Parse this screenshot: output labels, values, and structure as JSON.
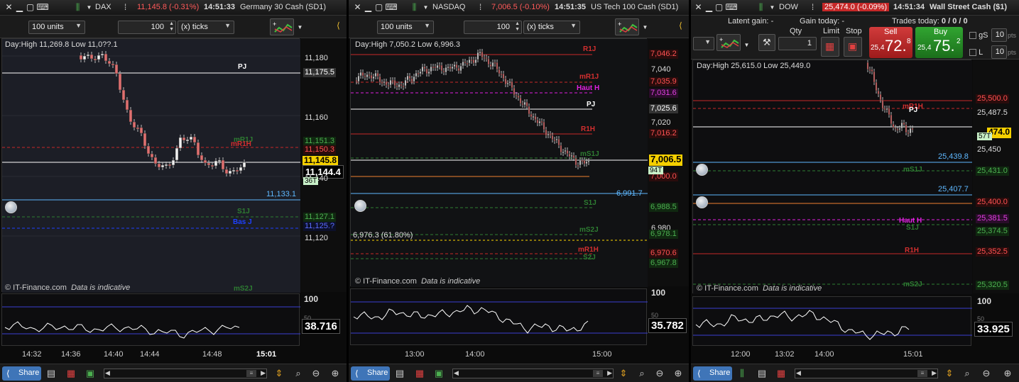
{
  "panels": [
    {
      "title": {
        "symbol": "DAX",
        "change": "11,145.8 (-0.31%)",
        "time": "14:51:33",
        "name": "Germany 30 Cash (SD1)"
      },
      "units": "100 units",
      "qty": "100",
      "ticks": "(x) ticks",
      "dayhl": "Day:High 11,269.8 Low 11,0??.1",
      "yticks": [
        "11,180",
        "11,160",
        "11,140",
        "11,120"
      ],
      "levels": [
        {
          "name": "PJ",
          "price": "11,175.5"
        },
        {
          "name": "mR1H",
          "price": "11,150.3"
        },
        {
          "name": "mR1J",
          "price": "11,151.3"
        },
        {
          "name": "S1J",
          "price": "11,127.1"
        },
        {
          "name": "Bas J",
          "price": "11,125.?"
        },
        {
          "name": "mS2J",
          "price": ""
        }
      ],
      "last": "11,145.8",
      "bid": "11,144.4",
      "tick_badge": "36T",
      "alert_price": "11,133.1",
      "footer": "© IT-Finance.com",
      "footer_note": "Data is indicative",
      "osc": {
        "top": "100",
        "mid": "50",
        "value": "38.716"
      },
      "times": [
        "14:32",
        "14:36",
        "14:40",
        "14:44",
        "14:48",
        "15:01"
      ],
      "share": "Share"
    },
    {
      "title": {
        "symbol": "NASDAQ",
        "change": "7,006.5 (-0.10%)",
        "time": "14:51:35",
        "name": "US Tech 100 Cash (SD1)"
      },
      "units": "100 units",
      "qty": "100",
      "ticks": "(x) ticks",
      "dayhl": "Day:High 7,050.2 Low 6,996.3",
      "yticks": [
        "7,040",
        "7,020",
        "6,980"
      ],
      "levels": [
        {
          "name": "R1J",
          "price": "7,046.2"
        },
        {
          "name": "mR1J",
          "price": "7,035.9"
        },
        {
          "name": "Haut H",
          "price": "7,031.6"
        },
        {
          "name": "PJ",
          "price": "7,025.6"
        },
        {
          "name": "R1H",
          "price": "7,016.2"
        },
        {
          "name": "mS1J",
          "price": "7,000.0"
        },
        {
          "name": "S1J",
          "price": "6,988.5"
        },
        {
          "name": "mS2J",
          "price": "6,978.1"
        },
        {
          "name": "mR1H",
          "price": "6,970.6"
        },
        {
          "name": "S2J",
          "price": "6,967.8"
        }
      ],
      "last": "7,006.5",
      "tick_badge": "94T",
      "alert_price": "6,991.7",
      "fib": "6,976.3 (61.80%)",
      "footer": "© IT-Finance.com",
      "footer_note": "Data is indicative",
      "osc": {
        "top": "100",
        "mid": "50",
        "value": "35.782"
      },
      "times": [
        "13:00",
        "14:00",
        "15:00"
      ],
      "share": "Share"
    },
    {
      "title": {
        "symbol": "DOW",
        "change": "25,474.0 (-0.09%)",
        "time": "14:51:34",
        "name": "Wall Street Cash ($1)"
      },
      "trade": {
        "latent": "Latent gain:",
        "latent_val": "-",
        "gain_today": "Gain today:",
        "gain_val": "-",
        "trades_today": "Trades today:",
        "trades_val": "0 / 0 / 0",
        "qty_label": "Qty",
        "qty": "1",
        "limit": "Limit",
        "stop": "Stop",
        "sell": "Sell",
        "buy": "Buy",
        "sell_small": "25,4",
        "sell_big": "72.",
        "sell_sup": "8",
        "buy_small": "25,4",
        "buy_big": "75.",
        "buy_sup": "2",
        "gs": "gS",
        "gs_val": "10",
        "l": "L",
        "l_val": "10",
        "pts": "pts"
      },
      "dayhl": "Day:High 25,615.0 Low 25,449.0",
      "yticks": [
        "25,450"
      ],
      "levels": [
        {
          "name": "mR1H",
          "price": "25,500.0"
        },
        {
          "name": "PJ",
          "price": "25,487.5"
        },
        {
          "name": "mS1J",
          "price": "25,431.0"
        },
        {
          "name": "Haut H",
          "price": "25,381.5"
        },
        {
          "name": "S1J",
          "price": "25,374.5"
        },
        {
          "name": "R1H",
          "price": "25,352.5"
        },
        {
          "name": "mS2J",
          "price": "25,320.5"
        }
      ],
      "last": "25,474.0",
      "last_short": "474.0",
      "tick_badge": "57T",
      "alert1": "25,439.8",
      "alert2": "25,407.7",
      "orange_price": "25,400.0",
      "footer": "© IT-Finance.com",
      "footer_note": "Data is indicative",
      "osc": {
        "top": "100",
        "mid": "50",
        "value": "33.925"
      },
      "times": [
        "12:00",
        "13:02",
        "14:00",
        "15:01"
      ],
      "share": "Share"
    }
  ]
}
